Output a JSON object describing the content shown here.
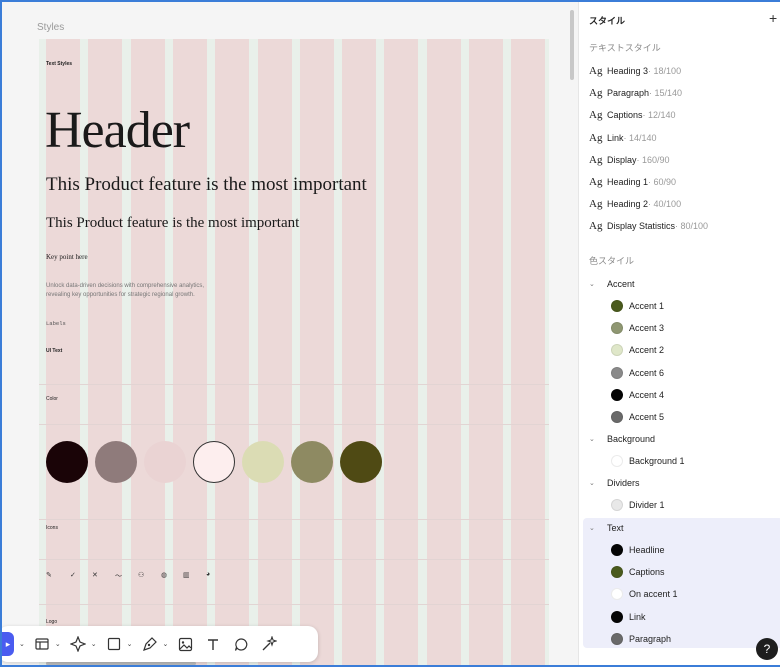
{
  "canvas": {
    "frame_label": "Styles",
    "section_text_styles": "Text Styles",
    "header_sample": "Header",
    "sub_sample_1": "This Product feature is the most important",
    "sub_sample_2": "This Product feature is the most important",
    "key_point": "Key point here",
    "body_sample": "Unlock data-driven decisions with comprehensive analytics, revealing key opportunities for strategic regional growth.",
    "labels_sample": "Labels",
    "ui_text_sample": "UI Text",
    "color_label": "Color",
    "icons_label": "Icons",
    "logo_label": "Logo",
    "swatches": [
      "#1a0407",
      "#8f7b7b",
      "#ead3d3",
      "#fdeeee",
      "#dbdcb4",
      "#8e8a62",
      "#4f4a14"
    ]
  },
  "toolbar": {
    "items": [
      "move-tool",
      "frame-tool",
      "component-tool",
      "shape-tool",
      "pen-tool",
      "image-tool",
      "text-tool",
      "comment-tool",
      "ai-tool"
    ]
  },
  "panel": {
    "title": "スタイル",
    "add_label": "+",
    "text_styles_heading": "テキストスタイル",
    "text_styles": [
      {
        "name": "Heading 3",
        "meta": " · 18/100"
      },
      {
        "name": "Paragraph",
        "meta": " · 15/140"
      },
      {
        "name": "Captions",
        "meta": " · 12/140"
      },
      {
        "name": "Link",
        "meta": " · 14/140"
      },
      {
        "name": "Display",
        "meta": " · 160/90"
      },
      {
        "name": "Heading 1",
        "meta": " · 60/90"
      },
      {
        "name": "Heading 2",
        "meta": " · 40/100"
      },
      {
        "name": "Display Statistics",
        "meta": " · 80/100"
      }
    ],
    "ag_glyph": "Ag",
    "color_styles_heading": "色スタイル",
    "groups": {
      "accent": "Accent",
      "background": "Background",
      "dividers": "Dividers",
      "text": "Text"
    },
    "accent_colors": [
      {
        "name": "Accent 1",
        "color": "#4a5a1d"
      },
      {
        "name": "Accent 3",
        "color": "#8f9772"
      },
      {
        "name": "Accent 2",
        "color": "#dfe7c9"
      },
      {
        "name": "Accent 6",
        "color": "#8a8a8a"
      },
      {
        "name": "Accent 4",
        "color": "#050505"
      },
      {
        "name": "Accent 5",
        "color": "#6a6a6a"
      }
    ],
    "background_colors": [
      {
        "name": "Background 1",
        "color": "#ffffff"
      }
    ],
    "divider_colors": [
      {
        "name": "Divider 1",
        "color": "#e8e8e8"
      }
    ],
    "text_colors": [
      {
        "name": "Headline",
        "color": "#050505"
      },
      {
        "name": "Captions",
        "color": "#4a5a1d"
      },
      {
        "name": "On accent 1",
        "color": "#ffffff"
      },
      {
        "name": "Link",
        "color": "#050505"
      },
      {
        "name": "Paragraph",
        "color": "#6a6a6a"
      }
    ],
    "help_label": "?"
  }
}
